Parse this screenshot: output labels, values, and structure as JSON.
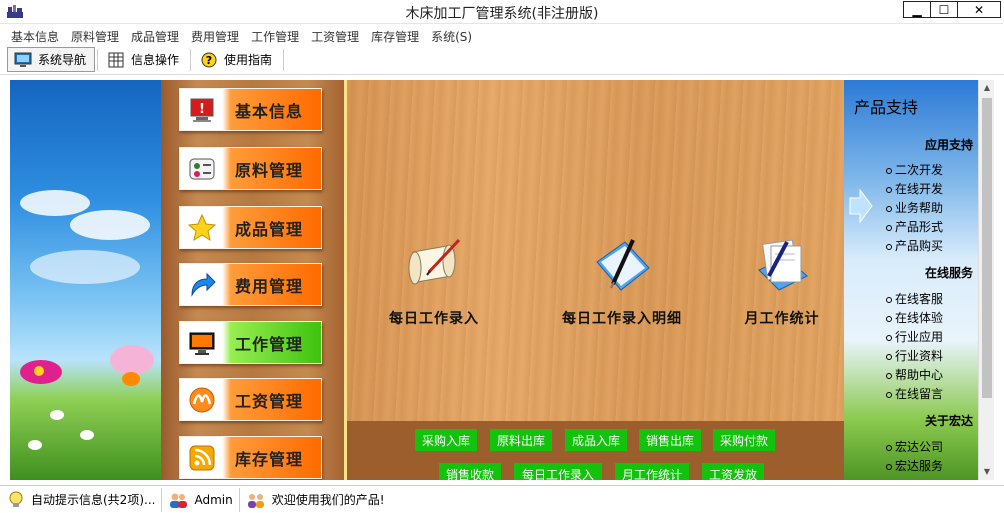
{
  "window": {
    "title": "木床加工厂管理系统(非注册版)",
    "min_glyph": "▁",
    "max_glyph": "☐",
    "close_glyph": "✕"
  },
  "menu": [
    "基本信息",
    "原料管理",
    "成品管理",
    "费用管理",
    "工作管理",
    "工资管理",
    "库存管理",
    "系统(S)"
  ],
  "toolbar": [
    {
      "label": "系统导航",
      "icon": "monitor-icon",
      "active": true
    },
    {
      "label": "信息操作",
      "icon": "grid-icon",
      "active": false
    },
    {
      "label": "使用指南",
      "icon": "help-icon",
      "active": false
    }
  ],
  "nav": [
    {
      "label": "基本信息",
      "icon": "computer-warning-icon",
      "active": false
    },
    {
      "label": "原料管理",
      "icon": "contacts-icon",
      "active": false
    },
    {
      "label": "成品管理",
      "icon": "star-icon",
      "active": false
    },
    {
      "label": "费用管理",
      "icon": "curved-arrow-icon",
      "active": false
    },
    {
      "label": "工作管理",
      "icon": "display-icon",
      "active": true
    },
    {
      "label": "工资管理",
      "icon": "wave-icon",
      "active": false
    },
    {
      "label": "库存管理",
      "icon": "rss-icon",
      "active": false
    }
  ],
  "tasks": [
    {
      "label": "每日工作录入",
      "icon": "scroll-pen-icon"
    },
    {
      "label": "每日工作录入明细",
      "icon": "notebook-pen-icon"
    },
    {
      "label": "月工作统计",
      "icon": "papers-pen-icon"
    }
  ],
  "quick_row1": [
    "采购入库",
    "原料出库",
    "成品入库",
    "销售出库",
    "采购付款"
  ],
  "quick_row2": [
    "销售收款",
    "每日工作录入",
    "月工作统计",
    "工资发放"
  ],
  "support": {
    "title": "产品支持",
    "sections": [
      {
        "heading": "应用支持",
        "links": [
          "二次开发",
          "在线开发",
          "业务帮助",
          "产品形式",
          "产品购买"
        ]
      },
      {
        "heading": "在线服务",
        "links": [
          "在线客服",
          "在线体验",
          "行业应用",
          "行业资料",
          "帮助中心",
          "在线留言"
        ]
      },
      {
        "heading": "关于宏达",
        "links": [
          "宏达公司",
          "宏达服务"
        ]
      }
    ]
  },
  "status": {
    "tips": "自动提示信息(共2项)...",
    "user": "Admin",
    "welcome": "欢迎使用我们的产品!"
  },
  "colors": {
    "nav_orange": "#ff6a00",
    "nav_active_green": "#3fc20e",
    "quick_green": "#13c20c",
    "quick_bar_bg": "#9b5e2c"
  }
}
